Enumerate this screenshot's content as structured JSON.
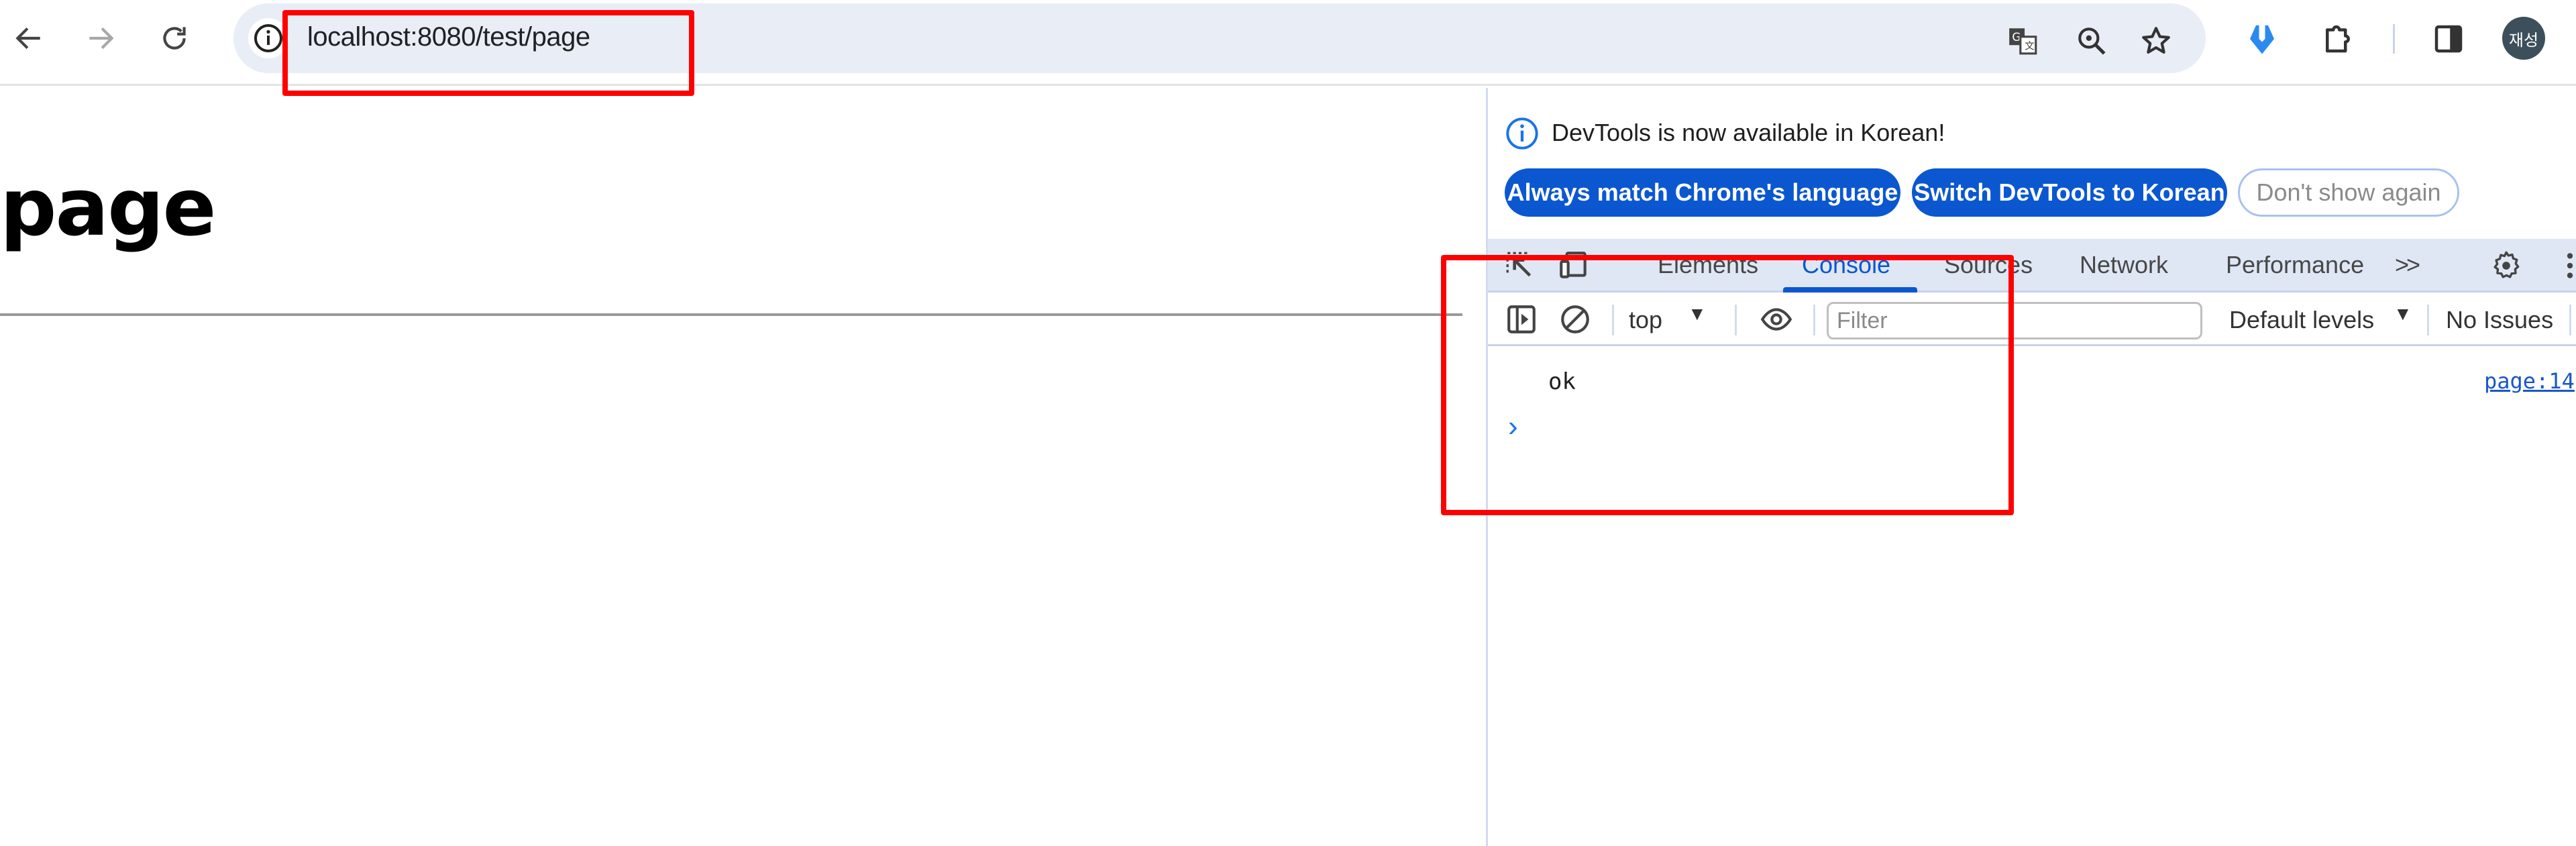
{
  "browser": {
    "url": "localhost:8080/test/page",
    "profile_initials": "재성",
    "toolbar_icons": [
      "back-icon",
      "forward-icon",
      "reload-icon",
      "site-info-icon",
      "translate-icon",
      "zoom-icon",
      "bookmark-star-icon",
      "extension-download-icon",
      "extensions-puzzle-icon",
      "side-panel-icon",
      "profile-avatar"
    ]
  },
  "page": {
    "heading": "page"
  },
  "devtools": {
    "infobar": {
      "message": "DevTools is now available in Korean!",
      "buttons": [
        {
          "label": "Always match Chrome's language"
        },
        {
          "label": "Switch DevTools to Korean"
        },
        {
          "label": "Don't show again"
        }
      ]
    },
    "tabs": [
      {
        "label": "Elements",
        "active": false
      },
      {
        "label": "Console",
        "active": true
      },
      {
        "label": "Sources",
        "active": false
      },
      {
        "label": "Network",
        "active": false
      },
      {
        "label": "Performance",
        "active": false
      }
    ],
    "more_tabs": ">>",
    "console_toolbar": {
      "context": "top",
      "filter_placeholder": "Filter",
      "filter_value": "",
      "levels": "Default levels",
      "issues": "No Issues"
    },
    "console": {
      "messages": [
        {
          "text": "ok",
          "source": "page:14"
        }
      ],
      "prompt": "›"
    }
  },
  "colors": {
    "accent": "#0b57d0",
    "annotation": "#ff0000",
    "toolbar_bg": "#dfe7f5"
  }
}
